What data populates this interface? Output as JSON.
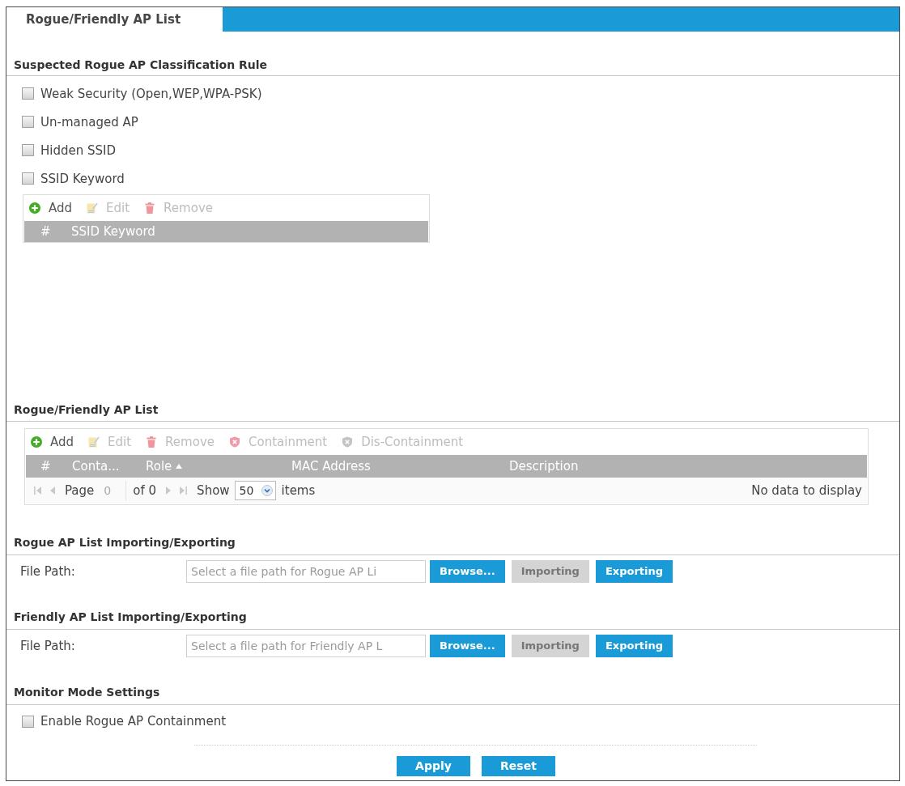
{
  "tabs": [
    {
      "label": "Rogue/Friendly AP List",
      "selected": true
    }
  ],
  "classification": {
    "heading": "Suspected Rogue AP Classification Rule",
    "rules": [
      {
        "label": "Weak Security (Open,WEP,WPA-PSK)",
        "checked": false
      },
      {
        "label": "Un-managed AP",
        "checked": false
      },
      {
        "label": "Hidden SSID",
        "checked": false
      },
      {
        "label": "SSID Keyword",
        "checked": false
      }
    ],
    "keyword_table": {
      "toolbar": [
        {
          "kind": "add",
          "label": "Add",
          "disabled": false
        },
        {
          "kind": "edit",
          "label": "Edit",
          "disabled": true
        },
        {
          "kind": "remove",
          "label": "Remove",
          "disabled": true
        }
      ],
      "columns": [
        {
          "label": "#"
        },
        {
          "label": "SSID Keyword"
        }
      ]
    }
  },
  "ap_list": {
    "heading": "Rogue/Friendly AP List",
    "toolbar": [
      {
        "kind": "add",
        "label": "Add",
        "disabled": false
      },
      {
        "kind": "edit",
        "label": "Edit",
        "disabled": true
      },
      {
        "kind": "remove",
        "label": "Remove",
        "disabled": true
      },
      {
        "kind": "containment",
        "label": "Containment",
        "disabled": true
      },
      {
        "kind": "dis_containment",
        "label": "Dis-Containment",
        "disabled": true
      }
    ],
    "columns": [
      {
        "label": "#"
      },
      {
        "label": "Conta..."
      },
      {
        "label": "Role",
        "sort_ascending": true
      },
      {
        "label": "MAC Address"
      },
      {
        "label": "Description"
      }
    ],
    "pager": {
      "page_label": "Page",
      "page": {
        "value": "0",
        "disabled": true
      },
      "total": "of 0",
      "show_label": "Show",
      "per_page": "50",
      "items_label": "items",
      "status": "No data to display"
    }
  },
  "import_export": [
    {
      "heading": "Rogue AP List Importing/Exporting",
      "label": "File Path:",
      "placeholder": "Select a file path for Rogue AP Li",
      "buttons": [
        {
          "label": "Browse...",
          "disabled": false
        },
        {
          "label": "Importing",
          "disabled": true
        },
        {
          "label": "Exporting",
          "disabled": false
        }
      ]
    },
    {
      "heading": "Friendly AP List Importing/Exporting",
      "label": "File Path:",
      "placeholder": "Select a file path for Friendly AP L",
      "buttons": [
        {
          "label": "Browse...",
          "disabled": false
        },
        {
          "label": "Importing",
          "disabled": true
        },
        {
          "label": "Exporting",
          "disabled": false
        }
      ]
    }
  ],
  "monitor": {
    "heading": "Monitor Mode Settings",
    "options": [
      {
        "label": "Enable Rogue AP Containment",
        "checked": false
      }
    ]
  },
  "actions": [
    {
      "label": "Apply"
    },
    {
      "label": "Reset"
    }
  ]
}
